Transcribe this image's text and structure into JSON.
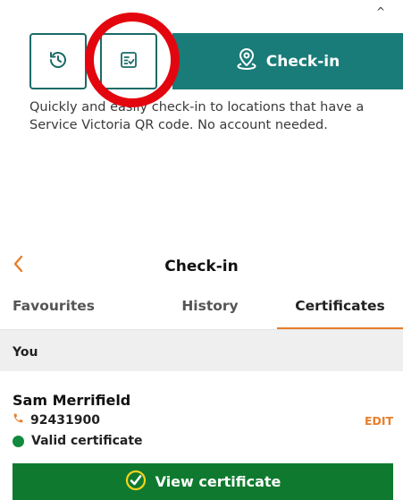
{
  "top_panel": {
    "status_glyph": "^",
    "history_icon": "history-icon",
    "certificate_icon": "certificate-icon",
    "checkin_label": "Check-in",
    "checkin_icon": "location-pin-icon",
    "description": "Quickly and easily check-in to locations that have a Service Victoria QR code. No account needed.",
    "accent_color": "#1a7c78",
    "highlight_ring_color": "#e3060f"
  },
  "screen": {
    "back_icon": "chevron-left-icon",
    "title": "Check-in",
    "tabs": [
      {
        "label": "Favourites"
      },
      {
        "label": "History"
      },
      {
        "label": "Certificates",
        "selected": true
      }
    ],
    "tab_accent_color": "#e97e2a",
    "section_label": "You",
    "person": {
      "name": "Sam Merrifield",
      "phone": "92431900",
      "edit_label": "EDIT",
      "status": "Valid certificate",
      "status_color": "#118a3b"
    },
    "view_button_label": "View certificate",
    "view_button_color": "#0f7a2f"
  }
}
